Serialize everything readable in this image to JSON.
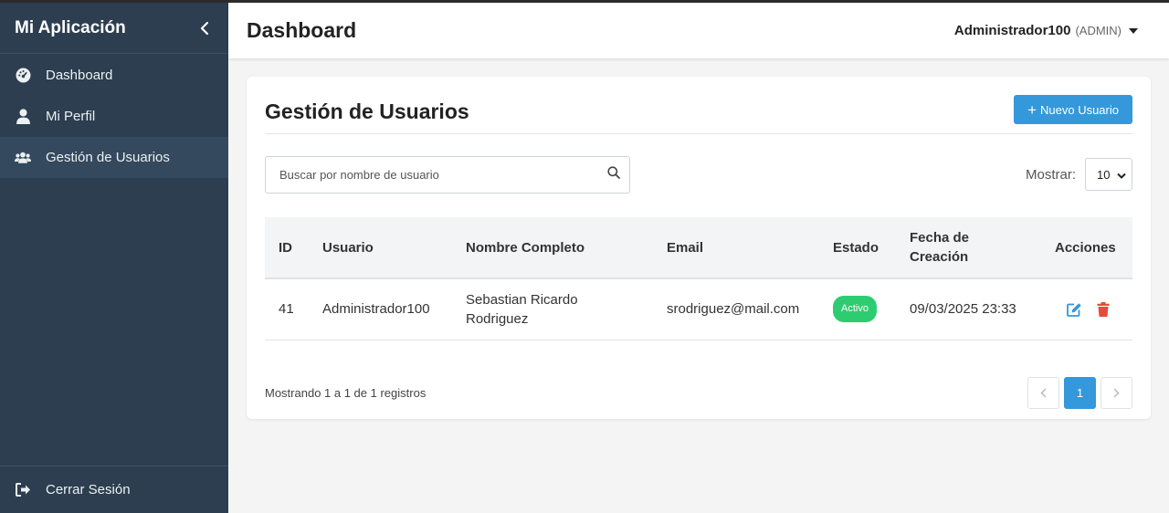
{
  "app": {
    "title": "Mi Aplicación"
  },
  "sidebar": {
    "items": [
      {
        "label": "Dashboard",
        "icon": "dashboard-icon"
      },
      {
        "label": "Mi Perfil",
        "icon": "user-icon"
      },
      {
        "label": "Gestión de Usuarios",
        "icon": "users-icon",
        "active": true
      }
    ],
    "logout_label": "Cerrar Sesión"
  },
  "header": {
    "title": "Dashboard",
    "user_name": "Administrador100",
    "user_role": "(ADMIN)"
  },
  "card": {
    "title": "Gestión de Usuarios",
    "new_button_label": "Nuevo Usuario"
  },
  "search": {
    "placeholder": "Buscar por nombre de usuario",
    "value": ""
  },
  "page_size": {
    "label": "Mostrar:",
    "value": "10"
  },
  "table": {
    "columns": {
      "id": "ID",
      "usuario": "Usuario",
      "nombre_line1": "Nombre Completo",
      "email": "Email",
      "estado": "Estado",
      "fecha_line1": "Fecha de",
      "fecha_line2": "Creación",
      "acciones": "Acciones"
    },
    "rows": [
      {
        "id": "41",
        "usuario": "Administrador100",
        "nombre_line1": "Sebastian Ricardo",
        "nombre_line2": "Rodriguez",
        "email": "srodriguez@mail.com",
        "estado": "Activo",
        "fecha": "09/03/2025 23:33"
      }
    ]
  },
  "footer": {
    "info": "Mostrando 1 a 1 de 1 registros",
    "pages": [
      "1"
    ],
    "current_page": "1"
  },
  "colors": {
    "sidebar_bg": "#2c3e50",
    "accent": "#3498db",
    "success": "#2ecc71",
    "danger": "#e74c3c"
  }
}
